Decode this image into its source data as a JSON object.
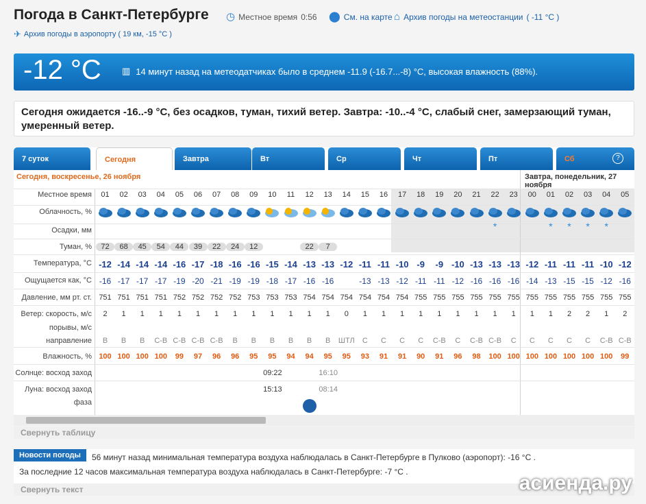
{
  "header": {
    "title": "Погода в Санкт-Петербурге",
    "local_time_label": "Местное время",
    "local_time": "0:56",
    "map_link": "См. на карте",
    "archive_station": "Архив погоды на метеостанции",
    "archive_station_temp": "( -11 °C )",
    "archive_airport": "Архив погоды в аэропорту ( 19 км, -15 °C )"
  },
  "now": {
    "temp": "-12 °C",
    "text": "14 минут назад на метеодатчиках было в среднем -11.9 (-16.7...-8) °С, высокая влажность (88%)."
  },
  "forecast": "Сегодня ожидается -16..-9 °C, без осадков, туман, тихий ветер. Завтра: -10..-4 °C, слабый снег, замерзающий туман, умеренный ветер.",
  "tabs": [
    "7 суток",
    "Сегодня",
    "Завтра",
    "Вт",
    "Ср",
    "Чт",
    "Пт",
    "Сб"
  ],
  "help": "?",
  "day1": "Сегодня, воскресенье, 26 ноября",
  "day2": "Завтра, понедельник, 27 ноября",
  "labels": {
    "time": "Местное время",
    "clouds": "Облачность, %",
    "precip": "Осадки, мм",
    "fog": "Туман, %",
    "temp": "Температура, °C",
    "feels": "Ощущается как, °C",
    "pressure": "Давление, мм рт. ст.",
    "wind": "Ветер: скорость, м/с",
    "gusts": "порывы, м/с",
    "direction": "направление",
    "humidity": "Влажность, %",
    "sun": "Солнце: восход заход",
    "moon": "Луна: восход заход",
    "phase": "фаза"
  },
  "hours": [
    "01",
    "02",
    "03",
    "04",
    "05",
    "06",
    "07",
    "08",
    "09",
    "10",
    "11",
    "12",
    "13",
    "14",
    "15",
    "16",
    "17",
    "18",
    "19",
    "20",
    "21",
    "22",
    "23",
    "00",
    "01",
    "02",
    "03",
    "04",
    "05"
  ],
  "fog": [
    "72",
    "68",
    "45",
    "54",
    "44",
    "39",
    "22",
    "24",
    "12",
    "",
    "",
    "22",
    "7",
    "",
    "",
    "",
    "",
    "",
    "",
    "",
    "",
    "",
    "",
    "",
    "",
    "",
    "",
    "",
    ""
  ],
  "temp": [
    "-12",
    "-14",
    "-14",
    "-14",
    "-16",
    "-17",
    "-18",
    "-16",
    "-16",
    "-15",
    "-14",
    "-13",
    "-13",
    "-12",
    "-11",
    "-11",
    "-10",
    "-9",
    "-9",
    "-10",
    "-13",
    "-13",
    "-13",
    "-12",
    "-11",
    "-11",
    "-11",
    "-10",
    "-12"
  ],
  "feels": [
    "-16",
    "-17",
    "-17",
    "-17",
    "-19",
    "-20",
    "-21",
    "-19",
    "-19",
    "-18",
    "-17",
    "-16",
    "-16",
    "",
    "-13",
    "-13",
    "-12",
    "-11",
    "-11",
    "-12",
    "-16",
    "-16",
    "-16",
    "-14",
    "-13",
    "-15",
    "-15",
    "-12",
    "-16"
  ],
  "pressure": [
    "751",
    "751",
    "751",
    "751",
    "752",
    "752",
    "752",
    "752",
    "753",
    "753",
    "753",
    "754",
    "754",
    "754",
    "754",
    "754",
    "754",
    "755",
    "755",
    "755",
    "755",
    "755",
    "755",
    "755",
    "755",
    "755",
    "755",
    "755",
    "755"
  ],
  "wind": [
    "2",
    "1",
    "1",
    "1",
    "1",
    "1",
    "1",
    "1",
    "1",
    "1",
    "1",
    "1",
    "1",
    "0",
    "1",
    "1",
    "1",
    "1",
    "1",
    "1",
    "1",
    "1",
    "1",
    "1",
    "1",
    "2",
    "2",
    "1",
    "2"
  ],
  "direction": [
    "В",
    "В",
    "В",
    "С-В",
    "С-В",
    "С-В",
    "С-В",
    "В",
    "В",
    "В",
    "В",
    "В",
    "В",
    "ШТЛ",
    "С",
    "С",
    "С",
    "С",
    "С-В",
    "С",
    "С-В",
    "С-В",
    "С",
    "С",
    "С",
    "С",
    "С",
    "С-В",
    "С-В"
  ],
  "humidity": [
    "100",
    "100",
    "100",
    "100",
    "99",
    "97",
    "96",
    "96",
    "95",
    "95",
    "94",
    "94",
    "95",
    "95",
    "93",
    "91",
    "91",
    "90",
    "91",
    "96",
    "98",
    "100",
    "100",
    "100",
    "100",
    "100",
    "100",
    "100",
    "99"
  ],
  "sun": {
    "rise": "09:22",
    "set": "16:10"
  },
  "moon": {
    "rise": "15:13",
    "set": "08:14"
  },
  "collapse_table": "Свернуть таблицу",
  "news": {
    "badge": "Новости погоды",
    "line1": "56 минут назад минимальная температура воздуха наблюдалась в Санкт-Петербурге в Пулково (аэропорт): -16 °С .",
    "line2": "За последние 12 часов максимальная температура воздуха наблюдалась в Санкт-Петербурге: -7 °С ."
  },
  "collapse_text": "Свернуть текст",
  "watermark": "асиенда.ру"
}
